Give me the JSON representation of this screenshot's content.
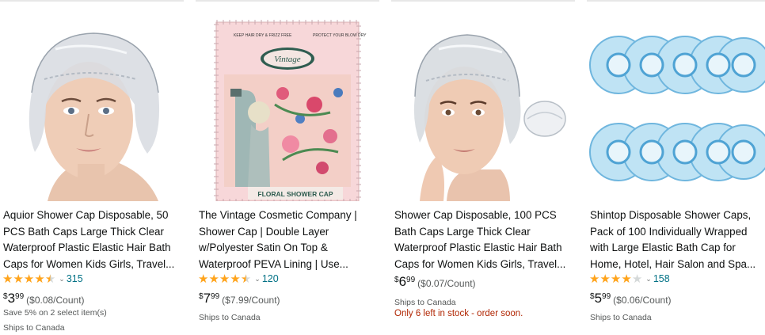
{
  "products": [
    {
      "title": "Aquior Shower Cap Disposable, 50 PCS Bath Caps Large Thick Clear Waterproof Plastic Elastic Hair Bath Caps for Women Kids Girls, Travel...",
      "rating_value": 4.5,
      "rating_count": "315",
      "price_symbol": "$",
      "price_whole": "3",
      "price_fraction": "99",
      "unit_price": "($0.08/Count)",
      "promo": "Save 5% on 2 select item(s)",
      "shipping": "Ships to Canada",
      "icon": "shower-cap-model-photo"
    },
    {
      "title": "The Vintage Cosmetic Company | Shower Cap | Double Layer w/Polyester Satin On Top & Waterproof PEVA Lining | Use...",
      "rating_value": 4.5,
      "rating_count": "120",
      "price_symbol": "$",
      "price_whole": "7",
      "price_fraction": "99",
      "unit_price": "($7.99/Count)",
      "shipping": "Ships to Canada",
      "package_text": {
        "brand": "Vintage",
        "left_tag": "KEEP HAIR DRY & FRIZZ FREE",
        "right_tag": "PROTECT YOUR BLOW DRY",
        "label": "FLORAL SHOWER CAP"
      }
    },
    {
      "title": "Shower Cap Disposable, 100 PCS Bath Caps Large Thick Clear Waterproof Plastic Elastic Hair Bath Caps for Women Kids Girls, Travel...",
      "price_symbol": "$",
      "price_whole": "6",
      "price_fraction": "99",
      "unit_price": "($0.07/Count)",
      "shipping": "Ships to Canada",
      "stock_warning": "Only 6 left in stock - order soon."
    },
    {
      "title": "Shintop Disposable Shower Caps, Pack of 100 Individually Wrapped with Large Elastic Bath Cap for Home, Hotel, Hair Salon and Spa...",
      "rating_value": 4,
      "rating_count": "158",
      "price_symbol": "$",
      "price_whole": "5",
      "price_fraction": "99",
      "unit_price": "($0.06/Count)",
      "shipping": "Ships to Canada"
    }
  ],
  "colors": {
    "star": "#ffa41c",
    "star_empty": "#d5d9d9",
    "link": "#007185",
    "stock_warning": "#b12704",
    "muted": "#565959"
  }
}
